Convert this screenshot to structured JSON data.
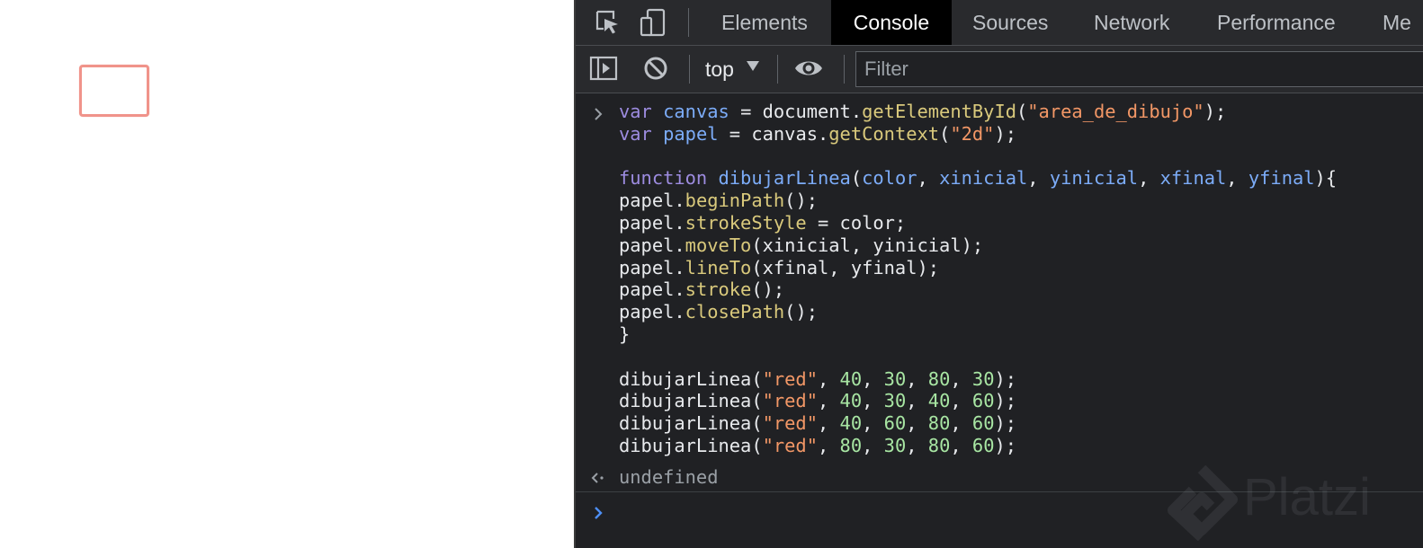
{
  "page": {
    "drawing": {
      "stroke_color": "#f0938a"
    }
  },
  "devtools": {
    "tabs": [
      {
        "label": "Elements",
        "active": false
      },
      {
        "label": "Console",
        "active": true
      },
      {
        "label": "Sources",
        "active": false
      },
      {
        "label": "Network",
        "active": false
      },
      {
        "label": "Performance",
        "active": false
      },
      {
        "label": "Me",
        "active": false
      }
    ],
    "toolbar": {
      "context": "top",
      "filter_placeholder": "Filter"
    },
    "console": {
      "result": "undefined",
      "watermark": "Platzi"
    }
  },
  "colors": {
    "devtools_background": "#202124",
    "keyword": "#9d8ce0",
    "variable": "#7cacf8",
    "method": "#d9c97c",
    "string": "#f29766",
    "number": "#a8e6a3",
    "prompt_active": "#4d8ff6"
  },
  "icons": [
    "inspect-icon",
    "device-toggle-icon",
    "sidebar-toggle-icon",
    "clear-console-icon",
    "eye-icon",
    "chevron-right-icon",
    "return-arrow-icon"
  ]
}
